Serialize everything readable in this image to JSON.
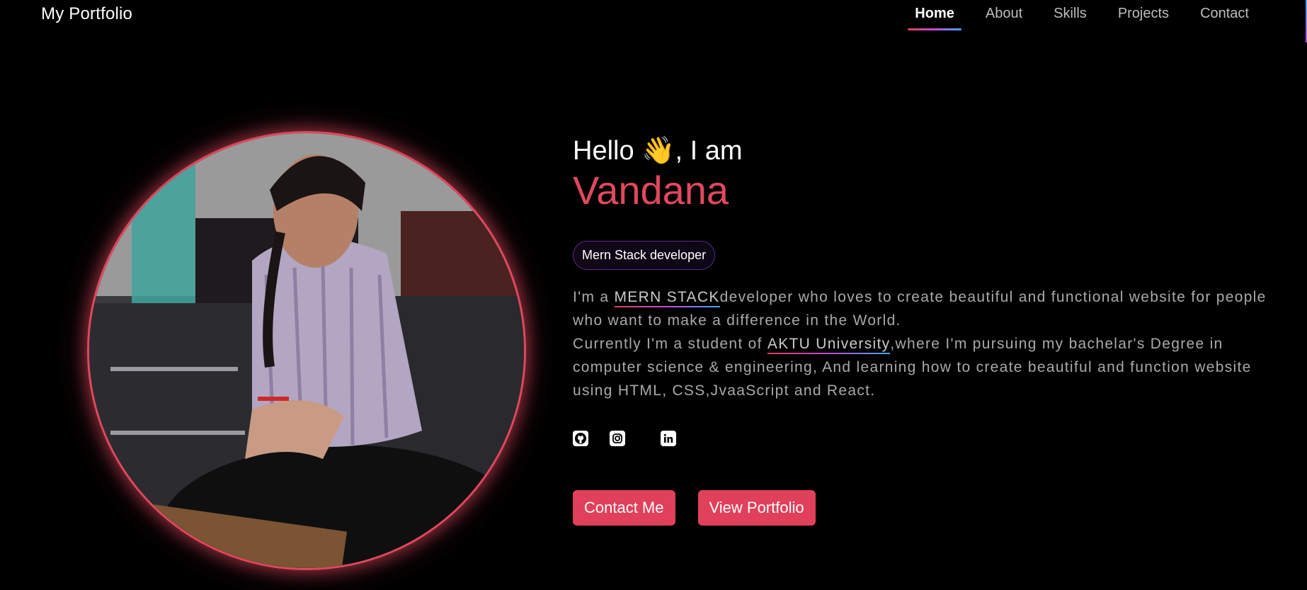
{
  "nav": {
    "brand": "My Portfolio",
    "links": [
      {
        "label": "Home",
        "active": true
      },
      {
        "label": "About",
        "active": false
      },
      {
        "label": "Skills",
        "active": false
      },
      {
        "label": "Projects",
        "active": false
      },
      {
        "label": "Contact",
        "active": false
      }
    ]
  },
  "hero": {
    "hello_prefix": "Hello",
    "wave_emoji": "👋",
    "hello_suffix": ", I am",
    "name": "Vandana",
    "badge": "Mern Stack developer",
    "desc_1a": "I'm a ",
    "desc_1_link": "MERN STACK ",
    "desc_1b": "developer who loves to create beautiful and functional website for people who want to make a difference in the World.",
    "desc_2a": "Currently I'm a student of ",
    "desc_2_link": "AKTU University ",
    "desc_2b": ",where I'm pursuing my bachelar's Degree in computer science & engineering, And learning how to create beautiful and function website using HTML, CSS,JvaaScript and React."
  },
  "socials": [
    "github-icon",
    "instagram-icon",
    "linkedin-icon"
  ],
  "buttons": {
    "contact": "Contact Me",
    "portfolio": "View Portfolio"
  },
  "colors": {
    "accent": "#e0485e",
    "background": "#000000"
  }
}
